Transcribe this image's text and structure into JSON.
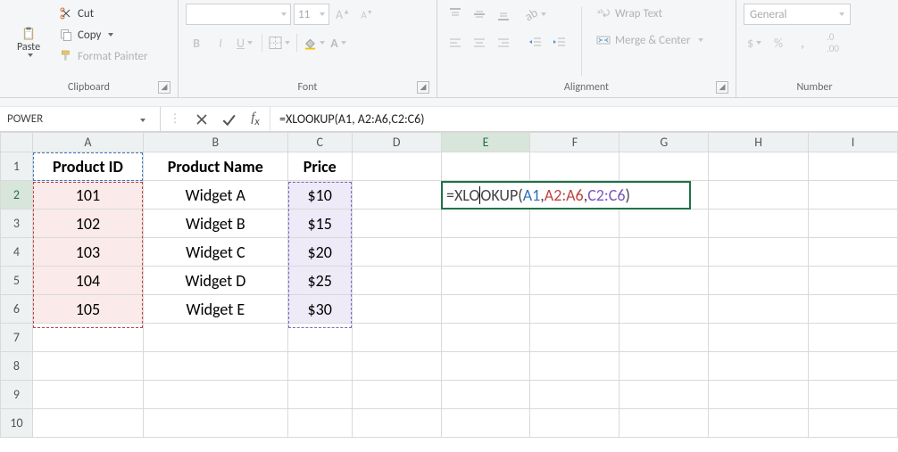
{
  "ribbon": {
    "clipboard": {
      "label": "Clipboard",
      "paste": "Paste",
      "cut": "Cut",
      "copy": "Copy",
      "format_painter": "Format Painter"
    },
    "font": {
      "label": "Font",
      "font_name_placeholder": "",
      "font_size_placeholder": "11"
    },
    "alignment": {
      "label": "Alignment",
      "wrap_text": "Wrap Text",
      "merge_center": "Merge & Center"
    },
    "number": {
      "label": "Number",
      "format_placeholder": "General"
    }
  },
  "formula_bar": {
    "name_box": "POWER",
    "formula": "=XLOOKUP(A1, A2:A6,C2:C6)"
  },
  "grid": {
    "columns": [
      "A",
      "B",
      "C",
      "D",
      "E",
      "F",
      "G",
      "H",
      "I"
    ],
    "row_count": 10,
    "headers": {
      "A1": "Product ID",
      "B1": "Product Name",
      "C1": "Price"
    },
    "data": {
      "A": [
        "101",
        "102",
        "103",
        "104",
        "105"
      ],
      "B": [
        "Widget A",
        "Widget B",
        "Widget C",
        "Widget D",
        "Widget E"
      ],
      "C": [
        "$10",
        "$15",
        "$20",
        "$25",
        "$30"
      ]
    },
    "editing_cell": "E2",
    "editing_parts": {
      "prefix": "=XLO",
      "mid": "OKUP(",
      "ref1": "A1",
      "sep1": ", ",
      "ref2": "A2:A6",
      "sep2": ",",
      "ref3": "C2:C6",
      "suffix": ")"
    }
  },
  "chart_data": {
    "type": "table",
    "columns": [
      "Product ID",
      "Product Name",
      "Price"
    ],
    "rows": [
      [
        "101",
        "Widget A",
        "$10"
      ],
      [
        "102",
        "Widget B",
        "$15"
      ],
      [
        "103",
        "Widget C",
        "$20"
      ],
      [
        "104",
        "Widget D",
        "$25"
      ],
      [
        "105",
        "Widget E",
        "$30"
      ]
    ]
  }
}
